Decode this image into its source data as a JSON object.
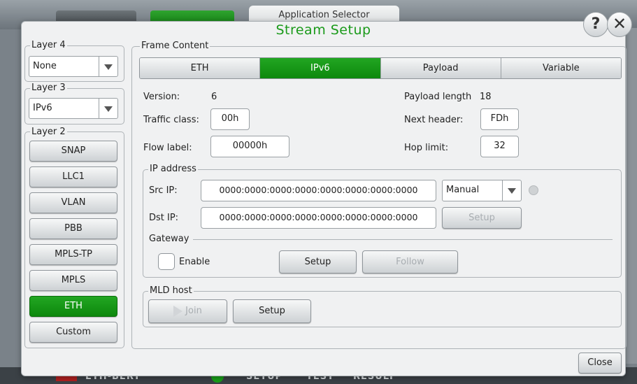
{
  "background": {
    "app_selector": "Application Selector",
    "bottom_bar": {
      "app": "ETH-BERT",
      "tabs": [
        "SETUP",
        "TEST",
        "RESULT"
      ]
    }
  },
  "dialog": {
    "title": "Stream Setup",
    "help_icon": "?",
    "close_icon": "✕",
    "close_label": "Close"
  },
  "layer4": {
    "label": "Layer 4",
    "value": "None"
  },
  "layer3": {
    "label": "Layer 3",
    "value": "IPv6"
  },
  "layer2": {
    "label": "Layer 2",
    "buttons": [
      "SNAP",
      "LLC1",
      "VLAN",
      "PBB",
      "MPLS-TP",
      "MPLS",
      "ETH",
      "Custom"
    ],
    "active": "ETH"
  },
  "frame": {
    "label": "Frame Content",
    "tabs": [
      "ETH",
      "IPv6",
      "Payload",
      "Variable"
    ],
    "active_tab": "IPv6",
    "version_label": "Version:",
    "version_value": "6",
    "traffic_class_label": "Traffic class:",
    "traffic_class_value": "00h",
    "flow_label_label": "Flow label:",
    "flow_label_value": "00000h",
    "payload_length_label": "Payload length",
    "payload_length_value": "18",
    "next_header_label": "Next header:",
    "next_header_value": "FDh",
    "hop_limit_label": "Hop limit:",
    "hop_limit_value": "32"
  },
  "ip_address": {
    "label": "IP address",
    "src_label": "Src IP:",
    "src_value": "0000:0000:0000:0000:0000:0000:0000:0000",
    "mode_value": "Manual",
    "dst_label": "Dst IP:",
    "dst_value": "0000:0000:0000:0000:0000:0000:0000:0000",
    "dst_setup": "Setup",
    "gateway_label": "Gateway",
    "enable_label": "Enable",
    "gateway_setup": "Setup",
    "follow_label": "Follow"
  },
  "mld": {
    "label": "MLD host",
    "join_label": "Join",
    "setup_label": "Setup"
  }
}
